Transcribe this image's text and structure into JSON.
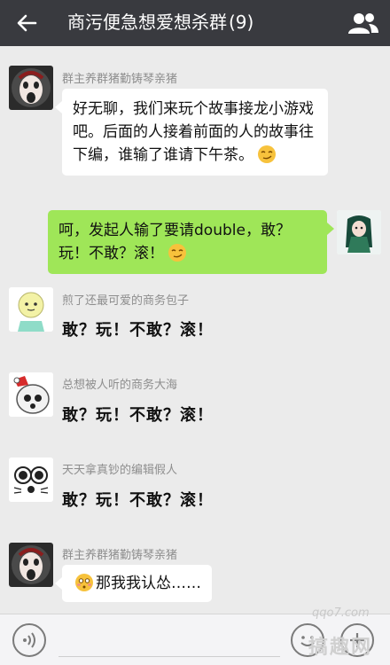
{
  "header": {
    "title": "商污便急想爱想杀群",
    "member_count": "(9)"
  },
  "messages": [
    {
      "sender": "群主养群猪勤铸琴亲猪",
      "text": "好无聊，我们来玩个故事接龙小游戏吧。后面的人接着前面的人的故事往下编，谁输了谁请下午茶。"
    },
    {
      "text": "呵，发起人输了要请double，敢？玩！不敢？滚！"
    },
    {
      "sender": "煎了还最可爱的商务包子",
      "text": "敢？玩！不敢？滚！"
    },
    {
      "sender": "总想被人听的商务大海",
      "text": "敢？玩！不敢？滚！"
    },
    {
      "sender": "天天拿真钞的编辑假人",
      "text": "敢？玩！不敢？滚！"
    },
    {
      "sender": "群主养群猪勤铸琴亲猪",
      "text": "那我我认怂……"
    }
  ],
  "watermark": {
    "url": "qqo7.com",
    "brand": "搞趣网"
  },
  "colors": {
    "topbar": "#393a3f",
    "background": "#ebebeb",
    "own_bubble": "#9fe658"
  }
}
